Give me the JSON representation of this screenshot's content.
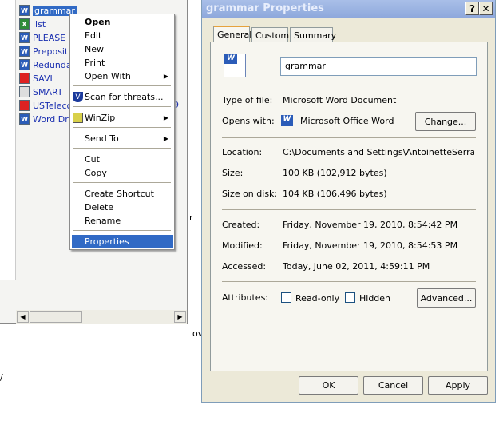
{
  "explorer": {
    "files": [
      {
        "name": "grammar",
        "type": "word",
        "selected": true
      },
      {
        "name": "list",
        "type": "excel"
      },
      {
        "name": "PLEASE",
        "type": "word"
      },
      {
        "name": "Prepositio",
        "type": "word"
      },
      {
        "name": "Redundar",
        "type": "word"
      },
      {
        "name": "SAVI",
        "type": "pdf"
      },
      {
        "name": "SMART",
        "type": "text"
      },
      {
        "name": "USTelecor",
        "type": "pdf"
      },
      {
        "name": "Word Drill",
        "type": "word"
      }
    ],
    "stray": {
      "a": "9",
      "b": "r",
      "c": "ov",
      "d": "/"
    }
  },
  "context_menu": {
    "items": {
      "open": "Open",
      "edit": "Edit",
      "new": "New",
      "print": "Print",
      "open_with": "Open With",
      "scan": "Scan for threats...",
      "winzip": "WinZip",
      "send_to": "Send To",
      "cut": "Cut",
      "copy": "Copy",
      "create_shortcut": "Create Shortcut",
      "delete": "Delete",
      "rename": "Rename",
      "properties": "Properties"
    }
  },
  "dialog": {
    "title": "grammar Properties",
    "help": "?",
    "close": "✕",
    "tabs": [
      "General",
      "Custom",
      "Summary"
    ],
    "name_value": "grammar",
    "type_label": "Type of file:",
    "type_value": "Microsoft Word Document",
    "opens_label": "Opens with:",
    "opens_value": "Microsoft Office Word",
    "change": "Change...",
    "location_label": "Location:",
    "location_value": "C:\\Documents and Settings\\AntoinetteSerra\\My D",
    "size_label": "Size:",
    "size_value": "100 KB (102,912 bytes)",
    "disk_label": "Size on disk:",
    "disk_value": "104 KB (106,496 bytes)",
    "created_label": "Created:",
    "created_value": "Friday, November 19, 2010, 8:54:42 PM",
    "modified_label": "Modified:",
    "modified_value": "Friday, November 19, 2010, 8:54:53 PM",
    "accessed_label": "Accessed:",
    "accessed_value": "Today, June 02, 2011, 4:59:11 PM",
    "attributes_label": "Attributes:",
    "readonly": "Read-only",
    "hidden": "Hidden",
    "readonly_checked": false,
    "hidden_checked": false,
    "advanced": "Advanced...",
    "ok": "OK",
    "cancel": "Cancel",
    "apply": "Apply"
  }
}
